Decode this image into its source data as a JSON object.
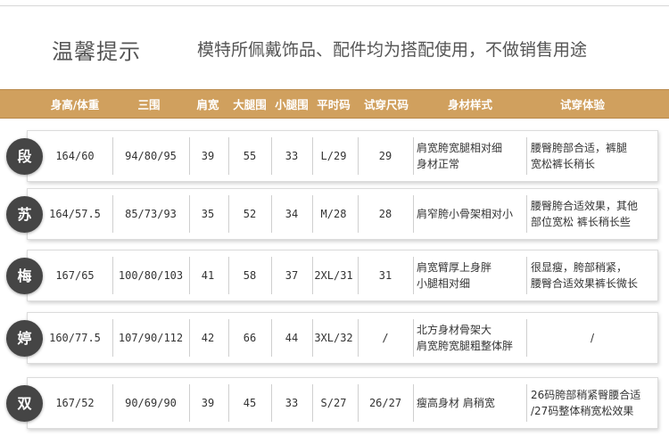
{
  "notice": {
    "title": "温馨提示",
    "text": "模特所佩戴饰品、配件均为搭配使用，不做销售用途"
  },
  "table": {
    "headers": [
      "身高/体重",
      "三围",
      "肩宽",
      "大腿围",
      "小腿围",
      "平时码",
      "试穿尺码",
      "身材样式",
      "试穿体验"
    ],
    "rows": [
      {
        "name": "段",
        "height_weight": "164/60",
        "measurements": "94/80/95",
        "shoulder": "39",
        "thigh": "55",
        "calf": "33",
        "usual_size": "L/29",
        "tried_size": "29",
        "body_type": [
          "肩宽胯宽腿相对细",
          "身材正常"
        ],
        "experience": [
          "腰臀胯部合适，裤腿",
          "宽松裤长稍长"
        ]
      },
      {
        "name": "苏",
        "height_weight": "164/57.5",
        "measurements": "85/73/93",
        "shoulder": "35",
        "thigh": "52",
        "calf": "34",
        "usual_size": "M/28",
        "tried_size": "28",
        "body_type": [
          "肩窄胯小骨架相对小"
        ],
        "experience": [
          "腰臀胯合适效果，其他",
          "部位宽松  裤长稍长些"
        ]
      },
      {
        "name": "梅",
        "height_weight": "167/65",
        "measurements": "100/80/103",
        "shoulder": "41",
        "thigh": "58",
        "calf": "37",
        "usual_size": "2XL/31",
        "tried_size": "31",
        "body_type": [
          "肩宽臂厚上身胖",
          "小腿相对细"
        ],
        "experience": [
          "很显瘦，胯部稍紧，",
          "腰臀合适效果裤长微长"
        ]
      },
      {
        "name": "婷",
        "height_weight": "160/77.5",
        "measurements": "107/90/112",
        "shoulder": "42",
        "thigh": "66",
        "calf": "44",
        "usual_size": "3XL/32",
        "tried_size": "/",
        "body_type": [
          "北方身材骨架大",
          "肩宽胯宽腿粗整体胖"
        ],
        "experience": [
          "/"
        ]
      },
      {
        "name": "双",
        "height_weight": "167/52",
        "measurements": "90/69/90",
        "shoulder": "39",
        "thigh": "45",
        "calf": "33",
        "usual_size": "S/27",
        "tried_size": "26/27",
        "body_type": [
          "瘦高身材  肩稍宽"
        ],
        "experience": [
          "26码胯部稍紧臀腰合适",
          "/27码整体稍宽松效果"
        ]
      }
    ]
  }
}
